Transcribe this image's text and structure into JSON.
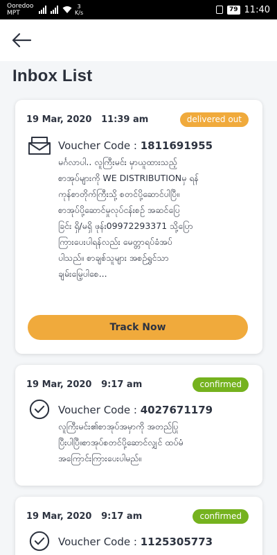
{
  "status_bar": {
    "carrier_line1": "Ooredoo",
    "carrier_line2": "MPT",
    "speed_value": "3",
    "speed_unit": "K/s",
    "battery": "79",
    "time": "11:40"
  },
  "header": {
    "title": "Inbox List",
    "back_icon": "arrow-left-icon"
  },
  "colors": {
    "accent": "#f0aa3c",
    "confirmed": "#75b21e",
    "text": "#2d3340",
    "background": "#f4f6f8"
  },
  "messages": [
    {
      "date": "19 Mar, 2020",
      "time": "11:39 am",
      "status": "delivered out",
      "icon": "envelope-icon",
      "voucher_label": "Voucher Code : ",
      "voucher_code": "1811691955",
      "lines": [
        "မင်္ဂလာပါ.. လူကြီးမင်း မှာယူထားသည့်",
        "စာအုပ်များကို WE DISTRIBUTIONမှ ရန်",
        "ကုန်စာတိုက်ကြီးသို့ စတင်ပို့ဆောင်ပါပြီ။",
        "စာအုပ်ပို့ဆောင်မှုလုပ်ငန်းစဉ် အဆင်ပြေ",
        "ခြင်း ရှိ/မရှိ ဖုန်း09972293371 သို့ပြော",
        "ကြားပေးပါရန်လည်း မေတ္တာရပ်ခံအပ်",
        "ပါသည်။ စာချစ်သူများ အစဉ်ရွှင်သာ",
        "ချမ်းမြေ့ပါစေ..."
      ],
      "button": "Track Now"
    },
    {
      "date": "19 Mar, 2020",
      "time": "9:17 am",
      "status": "confirmed",
      "icon": "check-circle-icon",
      "voucher_label": "Voucher Code : ",
      "voucher_code": "4027671179",
      "lines": [
        "လူကြီးမင်း၏စာအုပ်အမှာကို အတည်ပြု",
        "ပြီးပါပြီ။စာအုပ်စတင်ပို့ဆောင်လျှင် ထပ်မံ",
        "အကြောင်းကြားပေးပါမည်။"
      ]
    },
    {
      "date": "19 Mar, 2020",
      "time": "9:17 am",
      "status": "confirmed",
      "icon": "check-circle-icon",
      "voucher_label": "Voucher Code : ",
      "voucher_code": "1125305773",
      "lines": []
    }
  ]
}
